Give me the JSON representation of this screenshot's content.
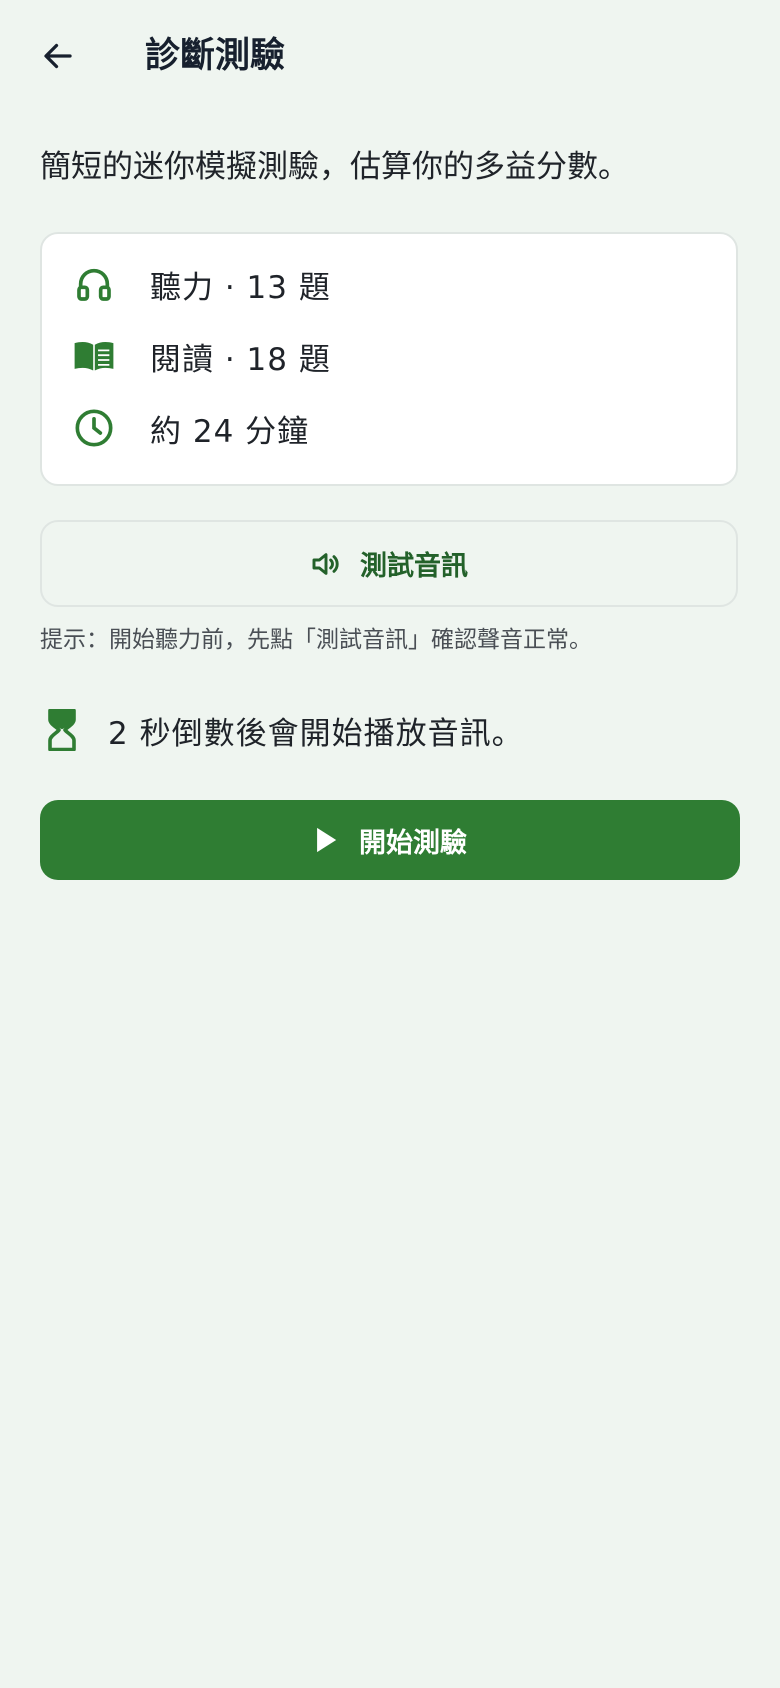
{
  "header": {
    "back_icon": "arrow-left-icon",
    "title": "診斷測驗"
  },
  "intro": {
    "text": "簡短的迷你模擬測驗，估算你的多益分數。"
  },
  "info": {
    "items": [
      {
        "icon": "headphones-icon",
        "label": "聽力 · 13 題"
      },
      {
        "icon": "book-icon",
        "label": "閱讀 · 18 題"
      },
      {
        "icon": "clock-icon",
        "label": "約 24 分鐘"
      }
    ]
  },
  "test_audio": {
    "icon": "speaker-icon",
    "label": "測試音訊"
  },
  "hint": {
    "text": "提示：開始聽力前，先點「測試音訊」確認聲音正常。"
  },
  "countdown": {
    "icon": "hourglass-icon",
    "text": "2 秒倒數後會開始播放音訊。"
  },
  "start": {
    "icon": "play-icon",
    "label": "開始測驗"
  },
  "colors": {
    "accent": "#2f7d33",
    "accent_dark": "#23612a",
    "background": "#eff5f0",
    "card": "#ffffff",
    "title_text": "#17202e"
  }
}
